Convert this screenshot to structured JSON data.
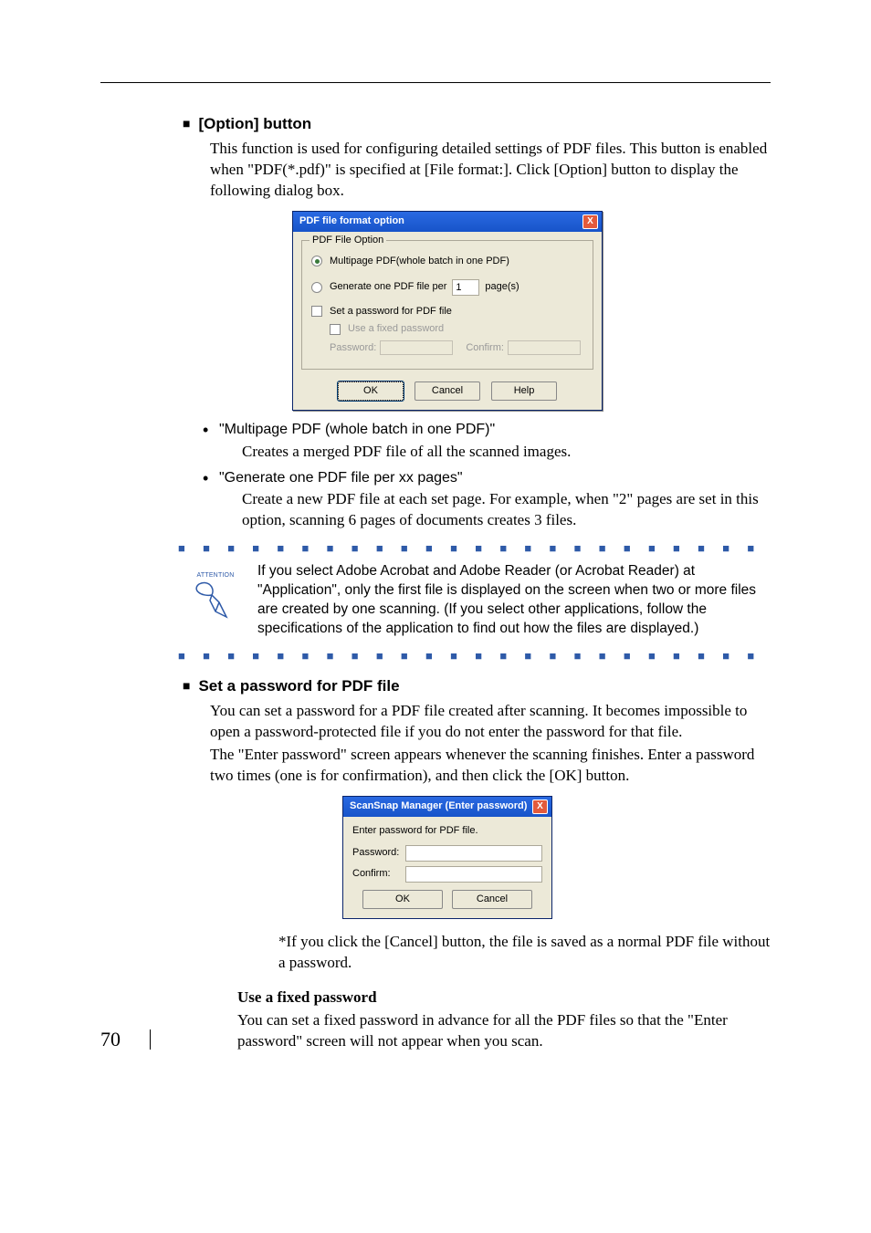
{
  "section1": {
    "heading": "[Option] button",
    "para": "This function is used for configuring detailed settings of PDF files. This button is enabled when \"PDF(*.pdf)\" is specified at [File format:]. Click [Option] button to display the following dialog box."
  },
  "pdfDialog": {
    "title": "PDF file format option",
    "close": "X",
    "groupLegend": "PDF File Option",
    "opt1": "Multipage PDF(whole batch in one PDF)",
    "opt2_pre": "Generate one PDF file per",
    "opt2_val": "1",
    "opt2_suf": "page(s)",
    "chk1": "Set a password for PDF file",
    "chk2": "Use a fixed password",
    "pwLabel": "Password:",
    "confirmLabel": "Confirm:",
    "ok": "OK",
    "cancel": "Cancel",
    "help": "Help"
  },
  "bullets": {
    "b1_head": "\"Multipage PDF (whole batch in one PDF)\"",
    "b1_body": "Creates a merged PDF file of all the scanned images.",
    "b2_head": "\"Generate one PDF file per xx pages\"",
    "b2_body": "Create a new PDF file at each set page. For example, when \"2\" pages are set in this option, scanning 6 pages of documents creates 3 files."
  },
  "attention": {
    "label": "ATTENTION",
    "text": "If you select Adobe Acrobat and Adobe Reader (or Acrobat Reader) at \"Application\", only the first file is displayed on the screen when two or more files are created by one scanning. (If you select other applications, follow the specifications of the application to find out how the files are displayed.)"
  },
  "section2": {
    "heading": "Set a password for PDF file",
    "para": "You can set a password for a PDF file created after scanning. It becomes impossible to open a password-protected file if you do not enter the password for that file.",
    "para2": "The \"Enter password\" screen appears whenever the scanning finishes. Enter a password two times (one is for confirmation), and then click the [OK] button."
  },
  "pwDialog": {
    "title": "ScanSnap Manager (Enter password)",
    "close": "X",
    "heading": "Enter password for PDF file.",
    "pwLabel": "Password:",
    "confirmLabel": "Confirm:",
    "ok": "OK",
    "cancel": "Cancel"
  },
  "note": "*If you click the [Cancel] button, the file is saved as a normal PDF file without a password.",
  "fixed": {
    "heading": "Use a fixed password",
    "para": "You can set a fixed password in advance for all the PDF files so that the \"Enter password\" screen will not appear when you scan."
  },
  "pageNumber": "70",
  "dashRow": "■ ■ ■ ■ ■ ■ ■ ■ ■ ■ ■ ■ ■ ■ ■ ■ ■ ■ ■ ■ ■ ■ ■ ■ ■ ■ ■ ■ ■ ■ ■ ■ ■ ■"
}
